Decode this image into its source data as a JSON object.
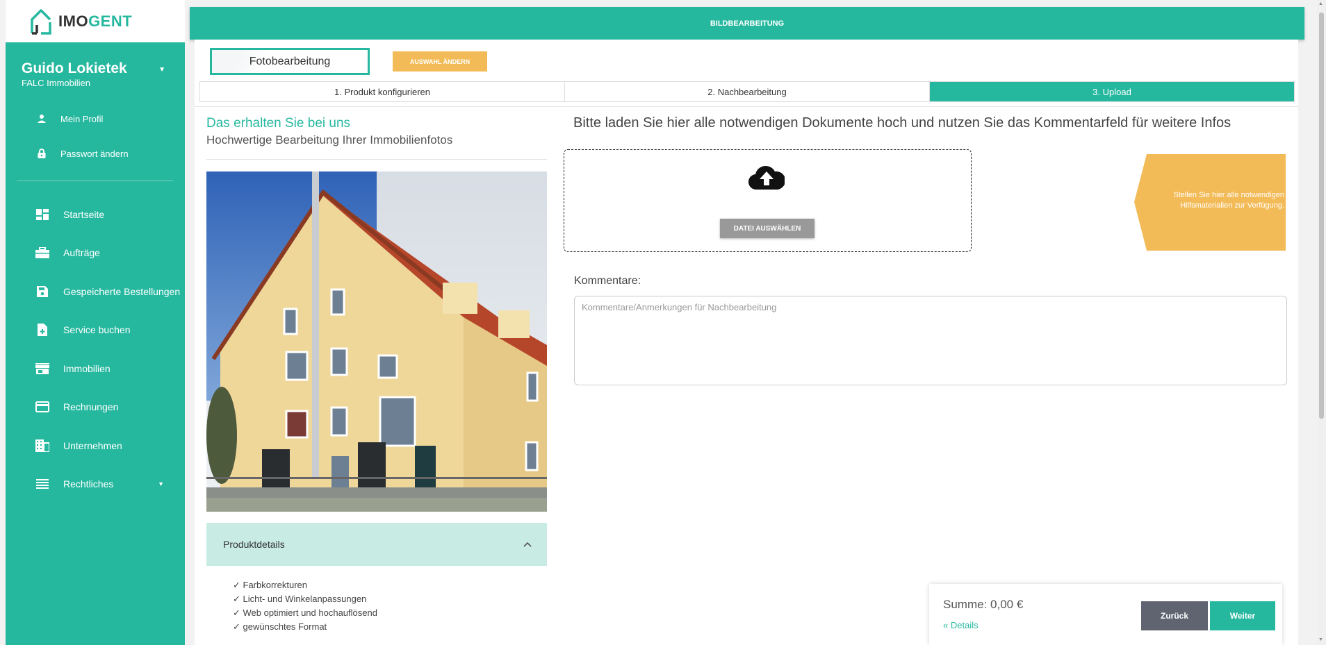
{
  "colors": {
    "accent": "#26b89f",
    "warning": "#f3bb58",
    "neutral_button": "#5f6470"
  },
  "brand": {
    "part1": "IMO",
    "part2": "GENT"
  },
  "user": {
    "name": "Guido Lokietek",
    "company": "FALC Immobilien"
  },
  "profile_links": [
    {
      "label": "Mein Profil",
      "icon": "person-icon"
    },
    {
      "label": "Passwort ändern",
      "icon": "lock-icon"
    }
  ],
  "nav": [
    {
      "label": "Startseite",
      "icon": "dashboard-icon"
    },
    {
      "label": "Aufträge",
      "icon": "briefcase-icon"
    },
    {
      "label": "Gespeicherte Bestellungen",
      "icon": "save-icon"
    },
    {
      "label": "Service buchen",
      "icon": "add-document-icon"
    },
    {
      "label": "Immobilien",
      "icon": "store-icon"
    },
    {
      "label": "Rechnungen",
      "icon": "credit-card-icon"
    },
    {
      "label": "Unternehmen",
      "icon": "building-icon"
    },
    {
      "label": "Rechtliches",
      "icon": "list-icon"
    }
  ],
  "header": {
    "title": "BILDBEARBEITUNG"
  },
  "product": {
    "selected": "Fotobearbeitung",
    "change_label": "AUSWAHL ÄNDERN"
  },
  "steps": [
    "1. Produkt konfigurieren",
    "2. Nachbearbeitung",
    "3. Upload"
  ],
  "active_step": 3,
  "left": {
    "title": "Das erhalten Sie bei uns",
    "subtitle": "Hochwertige Bearbeitung Ihrer Immobilienfotos",
    "accordion_label": "Produktdetails",
    "details": [
      "✓ Farbkorrekturen",
      "✓ Licht- und Winkelanpassungen",
      "✓ Web optimiert und hochauflösend",
      "✓ gewünschtes Format"
    ]
  },
  "upload": {
    "title": "Bitte laden Sie hier alle notwendigen Dokumente hoch und nutzen Sie das Kommentarfeld für weitere Infos",
    "button_label": "DATEI AUSWÄHLEN",
    "note_line1": "Stellen Sie hier alle notwendigen",
    "note_line2": "Hilfsmaterialien zur Verfügung."
  },
  "comments": {
    "label": "Kommentare:",
    "placeholder": "Kommentare/Anmerkungen für Nachbearbeitung",
    "value": ""
  },
  "summary": {
    "total": "Summe: 0,00 €",
    "details_label": "« Details",
    "back_label": "Zurück",
    "next_label": "Weiter"
  }
}
